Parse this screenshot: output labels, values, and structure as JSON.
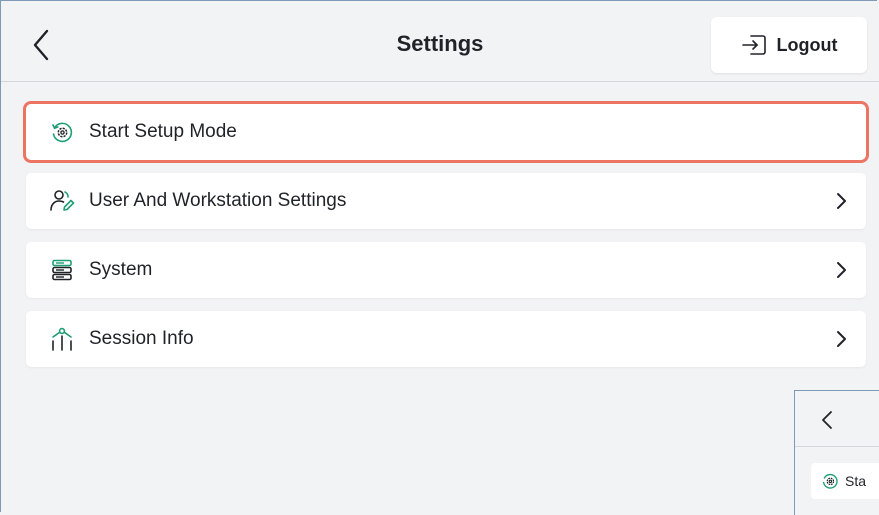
{
  "header": {
    "title": "Settings",
    "logout_label": "Logout"
  },
  "menu": {
    "items": [
      {
        "label": "Start Setup Mode",
        "icon": "setup-mode-icon",
        "has_chevron": false,
        "highlighted": true
      },
      {
        "label": "User And Workstation Settings",
        "icon": "user-edit-icon",
        "has_chevron": true
      },
      {
        "label": "System",
        "icon": "server-icon",
        "has_chevron": true
      },
      {
        "label": "Session Info",
        "icon": "session-info-icon",
        "has_chevron": true
      }
    ]
  },
  "thumbnail": {
    "label": "Sta"
  },
  "colors": {
    "accent_icon": "#1f9d74",
    "highlight_border": "#ec7463",
    "background": "#f2f3f5"
  }
}
